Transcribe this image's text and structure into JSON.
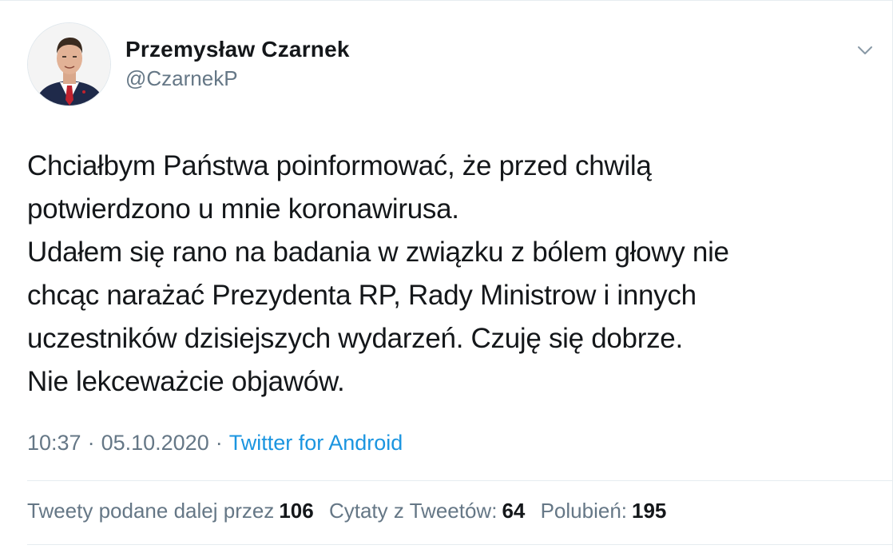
{
  "author": {
    "display_name": "Przemysław Czarnek",
    "handle": "@CzarnekP",
    "avatar_icon": "profile-photo"
  },
  "menu": {
    "icon": "chevron-down-icon"
  },
  "tweet": {
    "lines": [
      "Chciałbym Państwa poinformować, że przed chwilą",
      "potwierdzono u mnie koronawirusa.",
      "Udałem się rano na badania w związku z bólem głowy nie",
      "chcąc narażać Prezydenta RP, Rady Ministrow i innych",
      "uczestników dzisiejszych wydarzeń. Czuję się dobrze.",
      "Nie lekceważcie objawów."
    ]
  },
  "meta": {
    "time": "10:37",
    "separator": "·",
    "date": "05.10.2020",
    "source": "Twitter for Android",
    "source_color": "#1b95e0"
  },
  "stats": {
    "retweets_label": "Tweety podane dalej przez",
    "retweets_count": "106",
    "quotes_label": "Cytaty z Tweetów:",
    "quotes_count": "64",
    "likes_label": "Polubień:",
    "likes_count": "195"
  },
  "colors": {
    "text": "#14171a",
    "secondary": "#657786",
    "link": "#1b95e0",
    "divider": "#e6ecf0"
  }
}
